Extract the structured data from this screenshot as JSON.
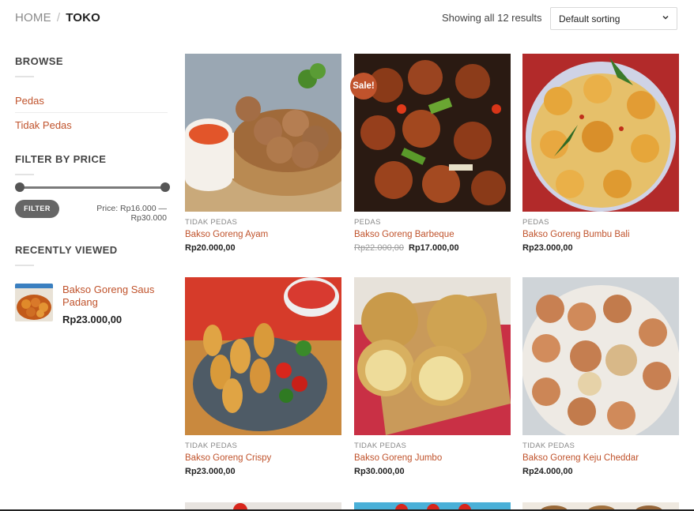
{
  "breadcrumb": {
    "home": "HOME",
    "separator": "/",
    "current": "TOKO"
  },
  "toolbar": {
    "results_text": "Showing all 12 results",
    "sort_selected": "Default sorting"
  },
  "sidebar": {
    "browse_title": "BROWSE",
    "categories": [
      {
        "label": "Pedas"
      },
      {
        "label": "Tidak Pedas"
      }
    ],
    "filter_title": "FILTER BY PRICE",
    "filter_button": "FILTER",
    "price_label": "Price: Rp16.000 — Rp30.000",
    "price_min": 16000,
    "price_max": 30000,
    "recent_title": "RECENTLY VIEWED",
    "recent_item": {
      "name": "Bakso Goreng Saus Padang",
      "price": "Rp23.000,00"
    }
  },
  "products": [
    {
      "category": "TIDAK PEDAS",
      "name": "Bakso Goreng Ayam",
      "price": "Rp20.000,00",
      "old_price": "",
      "sale_badge": ""
    },
    {
      "category": "PEDAS",
      "name": "Bakso Goreng Barbeque",
      "price": "Rp17.000,00",
      "old_price": "Rp22.000,00",
      "sale_badge": "Sale!"
    },
    {
      "category": "PEDAS",
      "name": "Bakso Goreng Bumbu Bali",
      "price": "Rp23.000,00",
      "old_price": "",
      "sale_badge": ""
    },
    {
      "category": "TIDAK PEDAS",
      "name": "Bakso Goreng Crispy",
      "price": "Rp23.000,00",
      "old_price": "",
      "sale_badge": ""
    },
    {
      "category": "TIDAK PEDAS",
      "name": "Bakso Goreng Jumbo",
      "price": "Rp30.000,00",
      "old_price": "",
      "sale_badge": ""
    },
    {
      "category": "TIDAK PEDAS",
      "name": "Bakso Goreng Keju Cheddar",
      "price": "Rp24.000,00",
      "old_price": "",
      "sale_badge": ""
    }
  ],
  "icons": {
    "sort_dropdown": "chevron-down-icon"
  },
  "colors": {
    "accent": "#c0532c",
    "button": "#666666"
  }
}
